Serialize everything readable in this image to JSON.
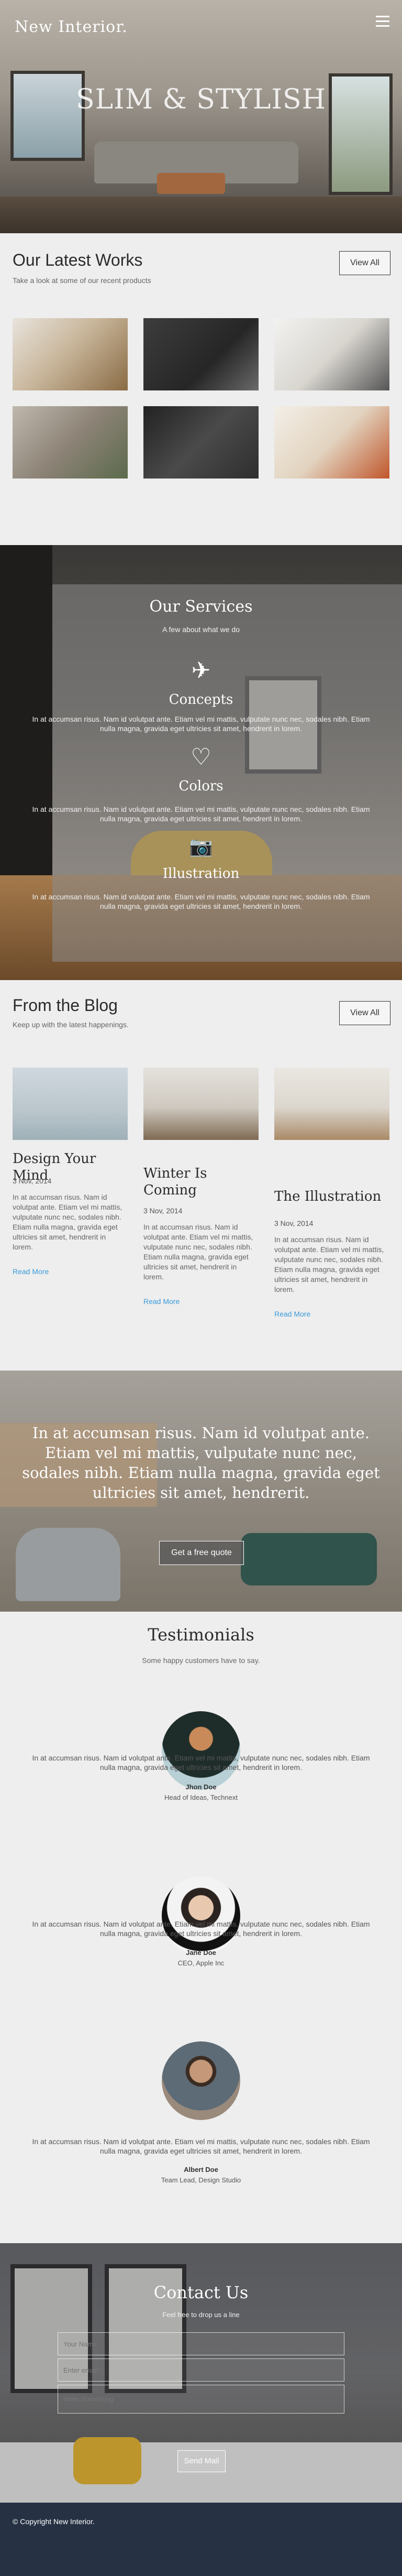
{
  "header": {
    "logo": "New Interior.",
    "hero_title": "SLIM & STYLISH",
    "hero_subtitle": ""
  },
  "works": {
    "title": "Our Latest Works",
    "subtitle": "Take a look at some of our recent products",
    "view_all": "View All",
    "items": [
      {
        "alt": "Staircase interior"
      },
      {
        "alt": "Dark kitchen"
      },
      {
        "alt": "Kitchen with stools"
      },
      {
        "alt": "Bedroom with plant"
      },
      {
        "alt": "Dark living space"
      },
      {
        "alt": "Bright living room with stairs"
      }
    ]
  },
  "services": {
    "title": "Our Services",
    "subtitle": "A few about what we do",
    "items": [
      {
        "icon": "paper-plane-icon",
        "glyph": "✈",
        "title": "Concepts",
        "text": "In at accumsan risus. Nam id volutpat ante. Etiam vel mi mattis, vulputate nunc nec, sodales nibh. Etiam nulla magna, gravida eget ultricies sit amet, hendrerit in lorem."
      },
      {
        "icon": "heart-icon",
        "glyph": "♡",
        "title": "Colors",
        "text": "In at accumsan risus. Nam id volutpat ante. Etiam vel mi mattis, vulputate nunc nec, sodales nibh. Etiam nulla magna, gravida eget ultricies sit amet, hendrerit in lorem."
      },
      {
        "icon": "camera-icon",
        "glyph": "📷",
        "title": "Illustration",
        "text": "In at accumsan risus. Nam id volutpat ante. Etiam vel mi mattis, vulputate nunc nec, sodales nibh. Etiam nulla magna, gravida eget ultricies sit amet, hendrerit in lorem."
      }
    ]
  },
  "blog": {
    "title": "From the Blog",
    "subtitle": "Keep up with the latest happenings.",
    "view_all": "View All",
    "posts": [
      {
        "title": "Design Your Mind",
        "date": "3 Nov, 2014",
        "text": "In at accumsan risus. Nam id volutpat ante. Etiam vel mi mattis, vulputate nunc nec, sodales nibh. Etiam nulla magna, gravida eget ultricies sit amet, hendrerit in lorem.",
        "link": "Read More"
      },
      {
        "title": "Winter Is Coming",
        "date": "3 Nov, 2014",
        "text": "In at accumsan risus. Nam id volutpat ante. Etiam vel mi mattis, vulputate nunc nec, sodales nibh. Etiam nulla magna, gravida eget ultricies sit amet, hendrerit in lorem.",
        "link": "Read More"
      },
      {
        "title": "The Illustration",
        "date": "3 Nov, 2014",
        "text": "In at accumsan risus. Nam id volutpat ante. Etiam vel mi mattis, vulputate nunc nec, sodales nibh. Etiam nulla magna, gravida eget ultricies sit amet, hendrerit in lorem.",
        "link": "Read More"
      }
    ]
  },
  "quote": {
    "text": "In at accumsan risus. Nam id volutpat ante. Etiam vel mi mattis, vulputate nunc nec, sodales nibh. Etiam nulla magna, gravida eget ultricies sit amet, hendrerit.",
    "button": "Get a free quote"
  },
  "testimonials": {
    "title": "Testimonials",
    "subtitle": "Some happy customers have to say.",
    "items": [
      {
        "text": "In at accumsan risus. Nam id volutpat ante. Etiam vel mi mattis, vulputate nunc nec, sodales nibh. Etiam nulla magna, gravida eget ultricies sit amet, hendrerit in lorem.",
        "name": "Jhon Doe",
        "role": "Head of Ideas, Technext"
      },
      {
        "text": "In at accumsan risus. Nam id volutpat ante. Etiam vel mi mattis, vulputate nunc nec, sodales nibh. Etiam nulla magna, gravida eget ultricies sit amet, hendrerit in lorem.",
        "name": "Jane Doe",
        "role": "CEO, Apple Inc"
      },
      {
        "text": "In at accumsan risus. Nam id volutpat ante. Etiam vel mi mattis, vulputate nunc nec, sodales nibh. Etiam nulla magna, gravida eget ultricies sit amet, hendrerit in lorem.",
        "name": "Albert Doe",
        "role": "Team Lead, Design Studio"
      }
    ]
  },
  "contact": {
    "title": "Contact Us",
    "subtitle": "Feel free to drop us a line",
    "name_placeholder": "Your Name",
    "email_placeholder": "Enter email",
    "message_placeholder": "Write Something",
    "send": "Send Mail"
  },
  "footer": {
    "copyright": "© Copyright New Interior."
  },
  "colors": {
    "footer_bg": "#263244",
    "link": "#3a9ad9",
    "accent_yellow": "#c99a1b"
  }
}
